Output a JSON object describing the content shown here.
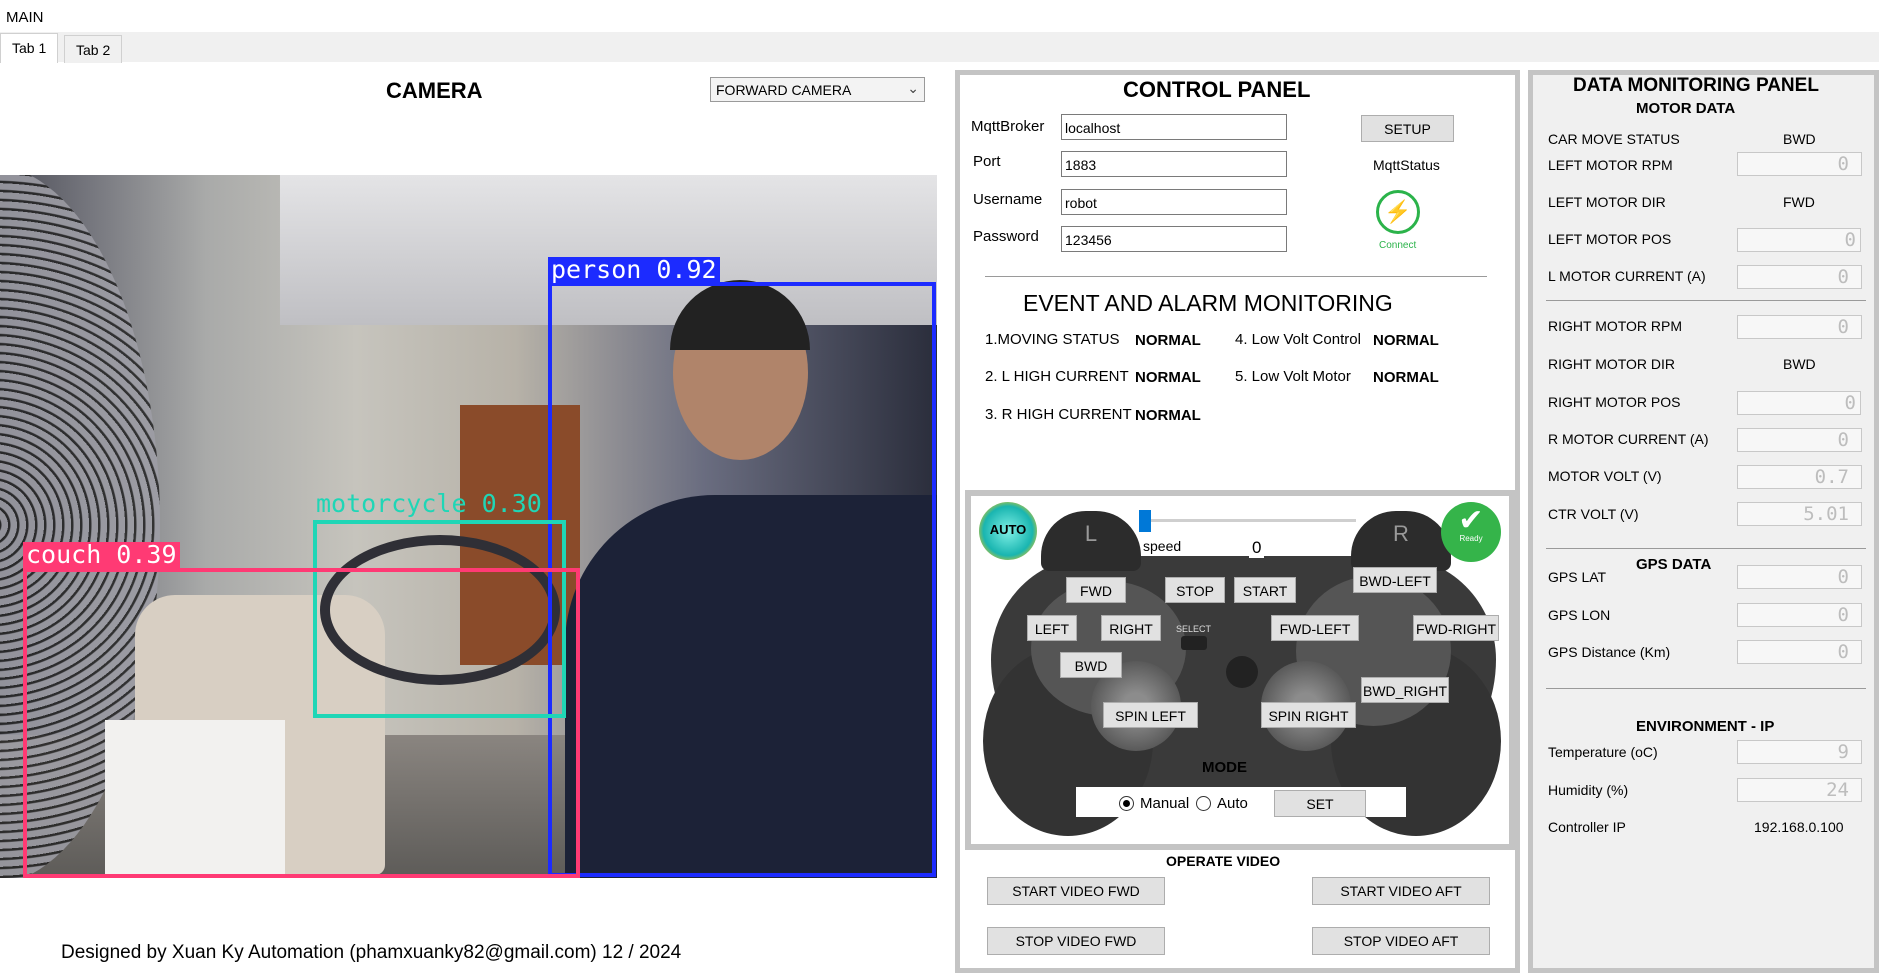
{
  "window": {
    "title": "MAIN"
  },
  "tabs": [
    {
      "label": "Tab 1"
    },
    {
      "label": "Tab 2"
    }
  ],
  "camera": {
    "title": "CAMERA",
    "selected_view": "FORWARD CAMERA",
    "detections": [
      {
        "label": "person 0.92",
        "color": "#1c2bff"
      },
      {
        "label": "motorcycle 0.30",
        "color": "#1fd6b6"
      },
      {
        "label": "couch 0.39",
        "color": "#ff3a74"
      }
    ]
  },
  "footer": {
    "text": "Designed by Xuan Ky Automation (phamxuanky82@gmail.com) 12 / 2024"
  },
  "control_panel": {
    "title": "CONTROL PANEL",
    "fields": [
      {
        "label": "MqttBroker",
        "value": "localhost"
      },
      {
        "label": "Port",
        "value": "1883"
      },
      {
        "label": "Username",
        "value": "robot"
      },
      {
        "label": "Password",
        "value": "123456"
      }
    ],
    "setup_label": "SETUP",
    "mqtt_status_label": "MqttStatus",
    "connect_label": "Connect",
    "event_title": "EVENT AND ALARM MONITORING",
    "events_left": [
      {
        "label": "1.MOVING STATUS",
        "value": "NORMAL"
      },
      {
        "label": "2. L HIGH CURRENT",
        "value": "NORMAL"
      },
      {
        "label": "3. R HIGH CURRENT",
        "value": "NORMAL"
      }
    ],
    "events_right": [
      {
        "label": "4. Low Volt Control",
        "value": "NORMAL"
      },
      {
        "label": "5. Low Volt Motor",
        "value": "NORMAL"
      }
    ],
    "gamepad": {
      "auto_badge": "AUTO",
      "ready_badge": "Ready",
      "shoulder_left": "L",
      "shoulder_right": "R",
      "speed_label": "speed",
      "speed_value": "0",
      "speed_fraction": 0,
      "select_text": "SELECT",
      "buttons": {
        "fwd": "FWD",
        "stop": "STOP",
        "start": "START",
        "bwd_left": "BWD-LEFT",
        "left": "LEFT",
        "right": "RIGHT",
        "fwd_left": "FWD-LEFT",
        "fwd_right": "FWD-RIGHT",
        "bwd": "BWD",
        "bwd_right": "BWD_RIGHT",
        "spin_left": "SPIN LEFT",
        "spin_right": "SPIN RIGHT"
      },
      "mode_title": "MODE",
      "mode_options": [
        {
          "label": "Manual",
          "selected": true
        },
        {
          "label": "Auto",
          "selected": false
        }
      ],
      "set_label": "SET"
    },
    "video": {
      "title": "OPERATE VIDEO",
      "start_fwd": "START VIDEO FWD",
      "start_aft": "START VIDEO AFT",
      "stop_fwd": "STOP VIDEO FWD",
      "stop_aft": "STOP VIDEO AFT"
    }
  },
  "monitor": {
    "title": "DATA MONITORING PANEL",
    "motor_title": "MOTOR DATA",
    "car_move_status": {
      "label": "CAR MOVE STATUS",
      "value": "BWD"
    },
    "left_motor_rpm": {
      "label": "LEFT MOTOR RPM",
      "value": "0"
    },
    "left_motor_dir": {
      "label": "LEFT MOTOR DIR",
      "value": "FWD"
    },
    "left_motor_pos": {
      "label": "LEFT MOTOR POS",
      "value": "0"
    },
    "l_motor_current": {
      "label": "L MOTOR CURRENT (A)",
      "value": "0"
    },
    "right_motor_rpm": {
      "label": "RIGHT MOTOR RPM",
      "value": "0"
    },
    "right_motor_dir": {
      "label": "RIGHT MOTOR DIR",
      "value": "BWD"
    },
    "right_motor_pos": {
      "label": "RIGHT MOTOR POS",
      "value": "0"
    },
    "r_motor_current": {
      "label": "R MOTOR CURRENT (A)",
      "value": "0"
    },
    "motor_volt": {
      "label": "MOTOR VOLT (V)",
      "value": "0.7"
    },
    "ctr_volt": {
      "label": "CTR VOLT (V)",
      "value": "5.01"
    },
    "gps_title": "GPS DATA",
    "gps_lat": {
      "label": "GPS LAT",
      "value": "0"
    },
    "gps_lon": {
      "label": "GPS LON",
      "value": "0"
    },
    "gps_distance": {
      "label": "GPS Distance (Km)",
      "value": "0"
    },
    "env_title": "ENVIRONMENT - IP",
    "temperature": {
      "label": "Temperature (oC)",
      "value": "9"
    },
    "humidity": {
      "label": "Humidity (%)",
      "value": "24"
    },
    "controller_ip": {
      "label": "Controller IP",
      "value": "192.168.0.100"
    }
  }
}
